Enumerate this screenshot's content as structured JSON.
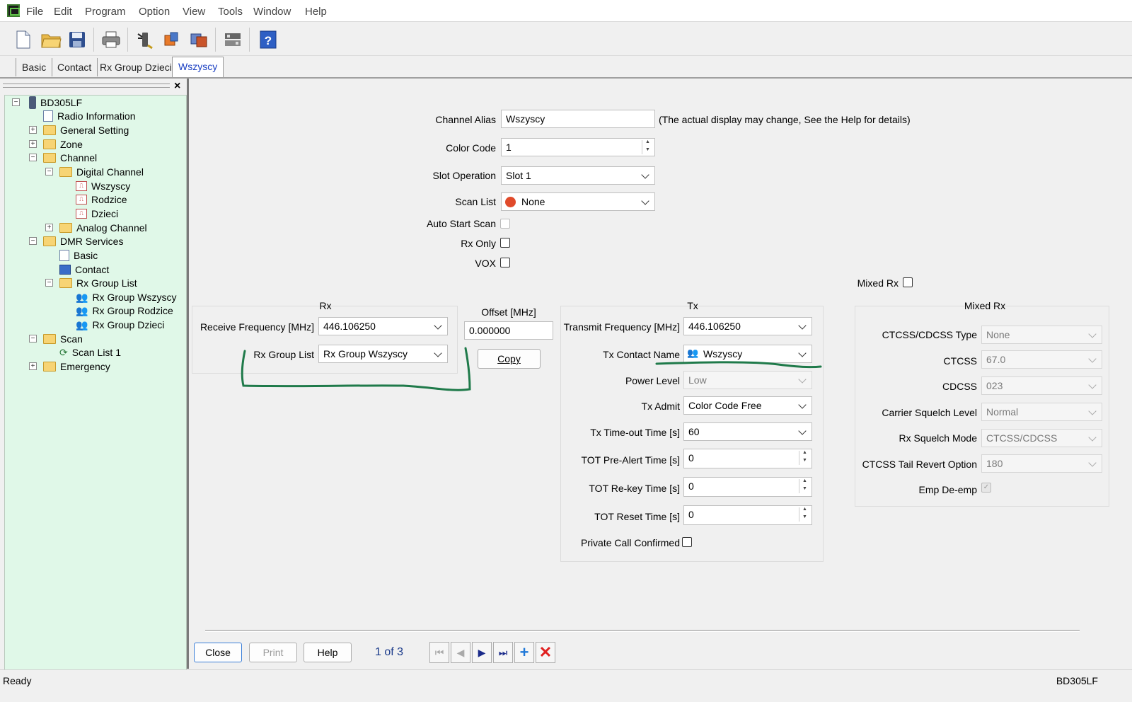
{
  "menu": [
    "File",
    "Edit",
    "Program",
    "Option",
    "View",
    "Tools",
    "Window",
    "Help"
  ],
  "toolbar_icons": [
    "new-file-icon",
    "open-folder-icon",
    "save-icon",
    "print-icon",
    "read-radio-icon",
    "write-radio-icon",
    "copy-radio-icon",
    "options-icon",
    "help-icon"
  ],
  "tabs": [
    "Basic",
    "Contact",
    "Rx Group Dzieci",
    "Wszyscy"
  ],
  "tree": {
    "close_glyph": "×",
    "root": "BD305LF",
    "radio_information": "Radio Information",
    "general_setting": "General Setting",
    "zone": "Zone",
    "channel": "Channel",
    "digital_channel": "Digital Channel",
    "wszyscy": "Wszyscy",
    "rodzice": "Rodzice",
    "dzieci": "Dzieci",
    "analog_channel": "Analog Channel",
    "dmr_services": "DMR Services",
    "basic": "Basic",
    "contact": "Contact",
    "rx_group_list": "Rx Group List",
    "rx_group_wszyscy": "Rx Group Wszyscy",
    "rx_group_rodzice": "Rx Group Rodzice",
    "rx_group_dzieci": "Rx Group Dzieci",
    "scan": "Scan",
    "scan_list_1": "Scan List 1",
    "emergency": "Emergency"
  },
  "form": {
    "channel_alias_label": "Channel Alias",
    "channel_alias": "Wszyscy",
    "alias_note": "(The actual display may change, See the Help for details)",
    "color_code_label": "Color Code",
    "color_code": "1",
    "slot_operation_label": "Slot Operation",
    "slot_operation": "Slot 1",
    "scan_list_label": "Scan List",
    "scan_list": "None",
    "auto_start_scan_label": "Auto Start Scan",
    "rx_only_label": "Rx Only",
    "vox_label": "VOX",
    "mixed_rx_label": "Mixed Rx"
  },
  "rx": {
    "title": "Rx",
    "receive_frequency_label": "Receive Frequency [MHz]",
    "receive_frequency": "446.106250",
    "rx_group_list_label": "Rx Group List",
    "rx_group_list": "Rx Group Wszyscy"
  },
  "offset": {
    "label": "Offset [MHz]",
    "value": "0.000000",
    "copy": "Copy"
  },
  "tx": {
    "title": "Tx",
    "transmit_frequency_label": "Transmit Frequency [MHz]",
    "transmit_frequency": "446.106250",
    "tx_contact_name_label": "Tx Contact Name",
    "tx_contact_name": "Wszyscy",
    "power_level_label": "Power Level",
    "power_level": "Low",
    "tx_admit_label": "Tx Admit",
    "tx_admit": "Color Code Free",
    "tx_timeout_label": "Tx Time-out Time [s]",
    "tx_timeout": "60",
    "tot_pre_alert_label": "TOT Pre-Alert Time [s]",
    "tot_pre_alert": "0",
    "tot_rekey_label": "TOT Re-key Time [s]",
    "tot_rekey": "0",
    "tot_reset_label": "TOT Reset Time [s]",
    "tot_reset": "0",
    "private_call_label": "Private Call Confirmed"
  },
  "mixed_rx": {
    "title": "Mixed Rx",
    "ctcss_cdcss_type_label": "CTCSS/CDCSS Type",
    "ctcss_cdcss_type": "None",
    "ctcss_label": "CTCSS",
    "ctcss": "67.0",
    "cdcss_label": "CDCSS",
    "cdcss": "023",
    "carrier_squelch_label": "Carrier Squelch Level",
    "carrier_squelch": "Normal",
    "rx_squelch_mode_label": "Rx Squelch Mode",
    "rx_squelch_mode": "CTCSS/CDCSS",
    "ctcss_tail_label": "CTCSS Tail Revert Option",
    "ctcss_tail": "180",
    "emp_deemp_label": "Emp De-emp"
  },
  "bottom": {
    "close": "Close",
    "print": "Print",
    "help": "Help",
    "page": "1 of 3"
  },
  "status": {
    "left": "Ready",
    "right": "BD305LF"
  },
  "colors": {
    "annotation": "#1f7a4a",
    "tree_bg": "#e0f8e8",
    "active_tab": "#1a3fc2"
  }
}
